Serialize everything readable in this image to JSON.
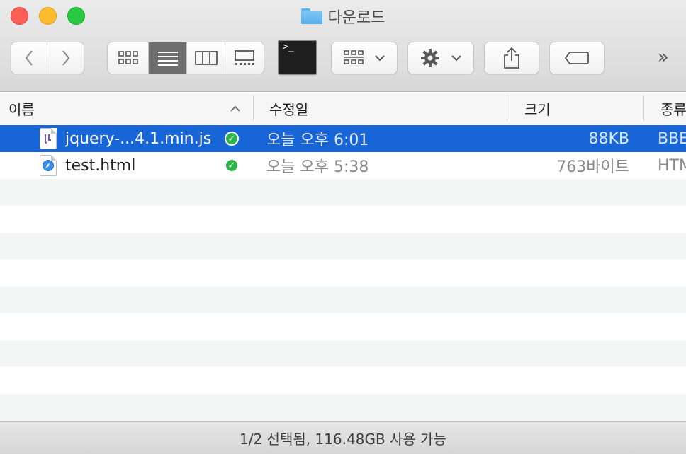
{
  "window": {
    "title": "다운로드",
    "folder_icon": "folder-icon"
  },
  "toolbar": {
    "back_icon": "chevron-left-icon",
    "forward_icon": "chevron-right-icon",
    "view_modes": [
      "icon-view",
      "list-view",
      "column-view",
      "gallery-view"
    ],
    "active_view": "list-view",
    "terminal_glyph": ">_",
    "overflow": "»"
  },
  "columns": [
    {
      "label": "이름",
      "sort": "ascending"
    },
    {
      "label": "수정일"
    },
    {
      "label": "크기"
    },
    {
      "label": "종류"
    }
  ],
  "files": [
    {
      "name": "jquery-...4.1.min.js",
      "modified": "오늘 오후 6:01",
      "size": "88KB",
      "kind": "BBE",
      "status": "synced",
      "selected": true,
      "icon": "js-file-icon"
    },
    {
      "name": "test.html",
      "modified": "오늘 오후 5:38",
      "size": "763바이트",
      "kind": "HTM",
      "status": "synced",
      "selected": false,
      "icon": "html-file-icon"
    }
  ],
  "status_bar": {
    "text": "1/2 선택됨, 116.48GB 사용 가능"
  },
  "colors": {
    "selection": "#1765d6",
    "alt_row": "#f4f5f5",
    "sync_check": "#2ab546"
  }
}
